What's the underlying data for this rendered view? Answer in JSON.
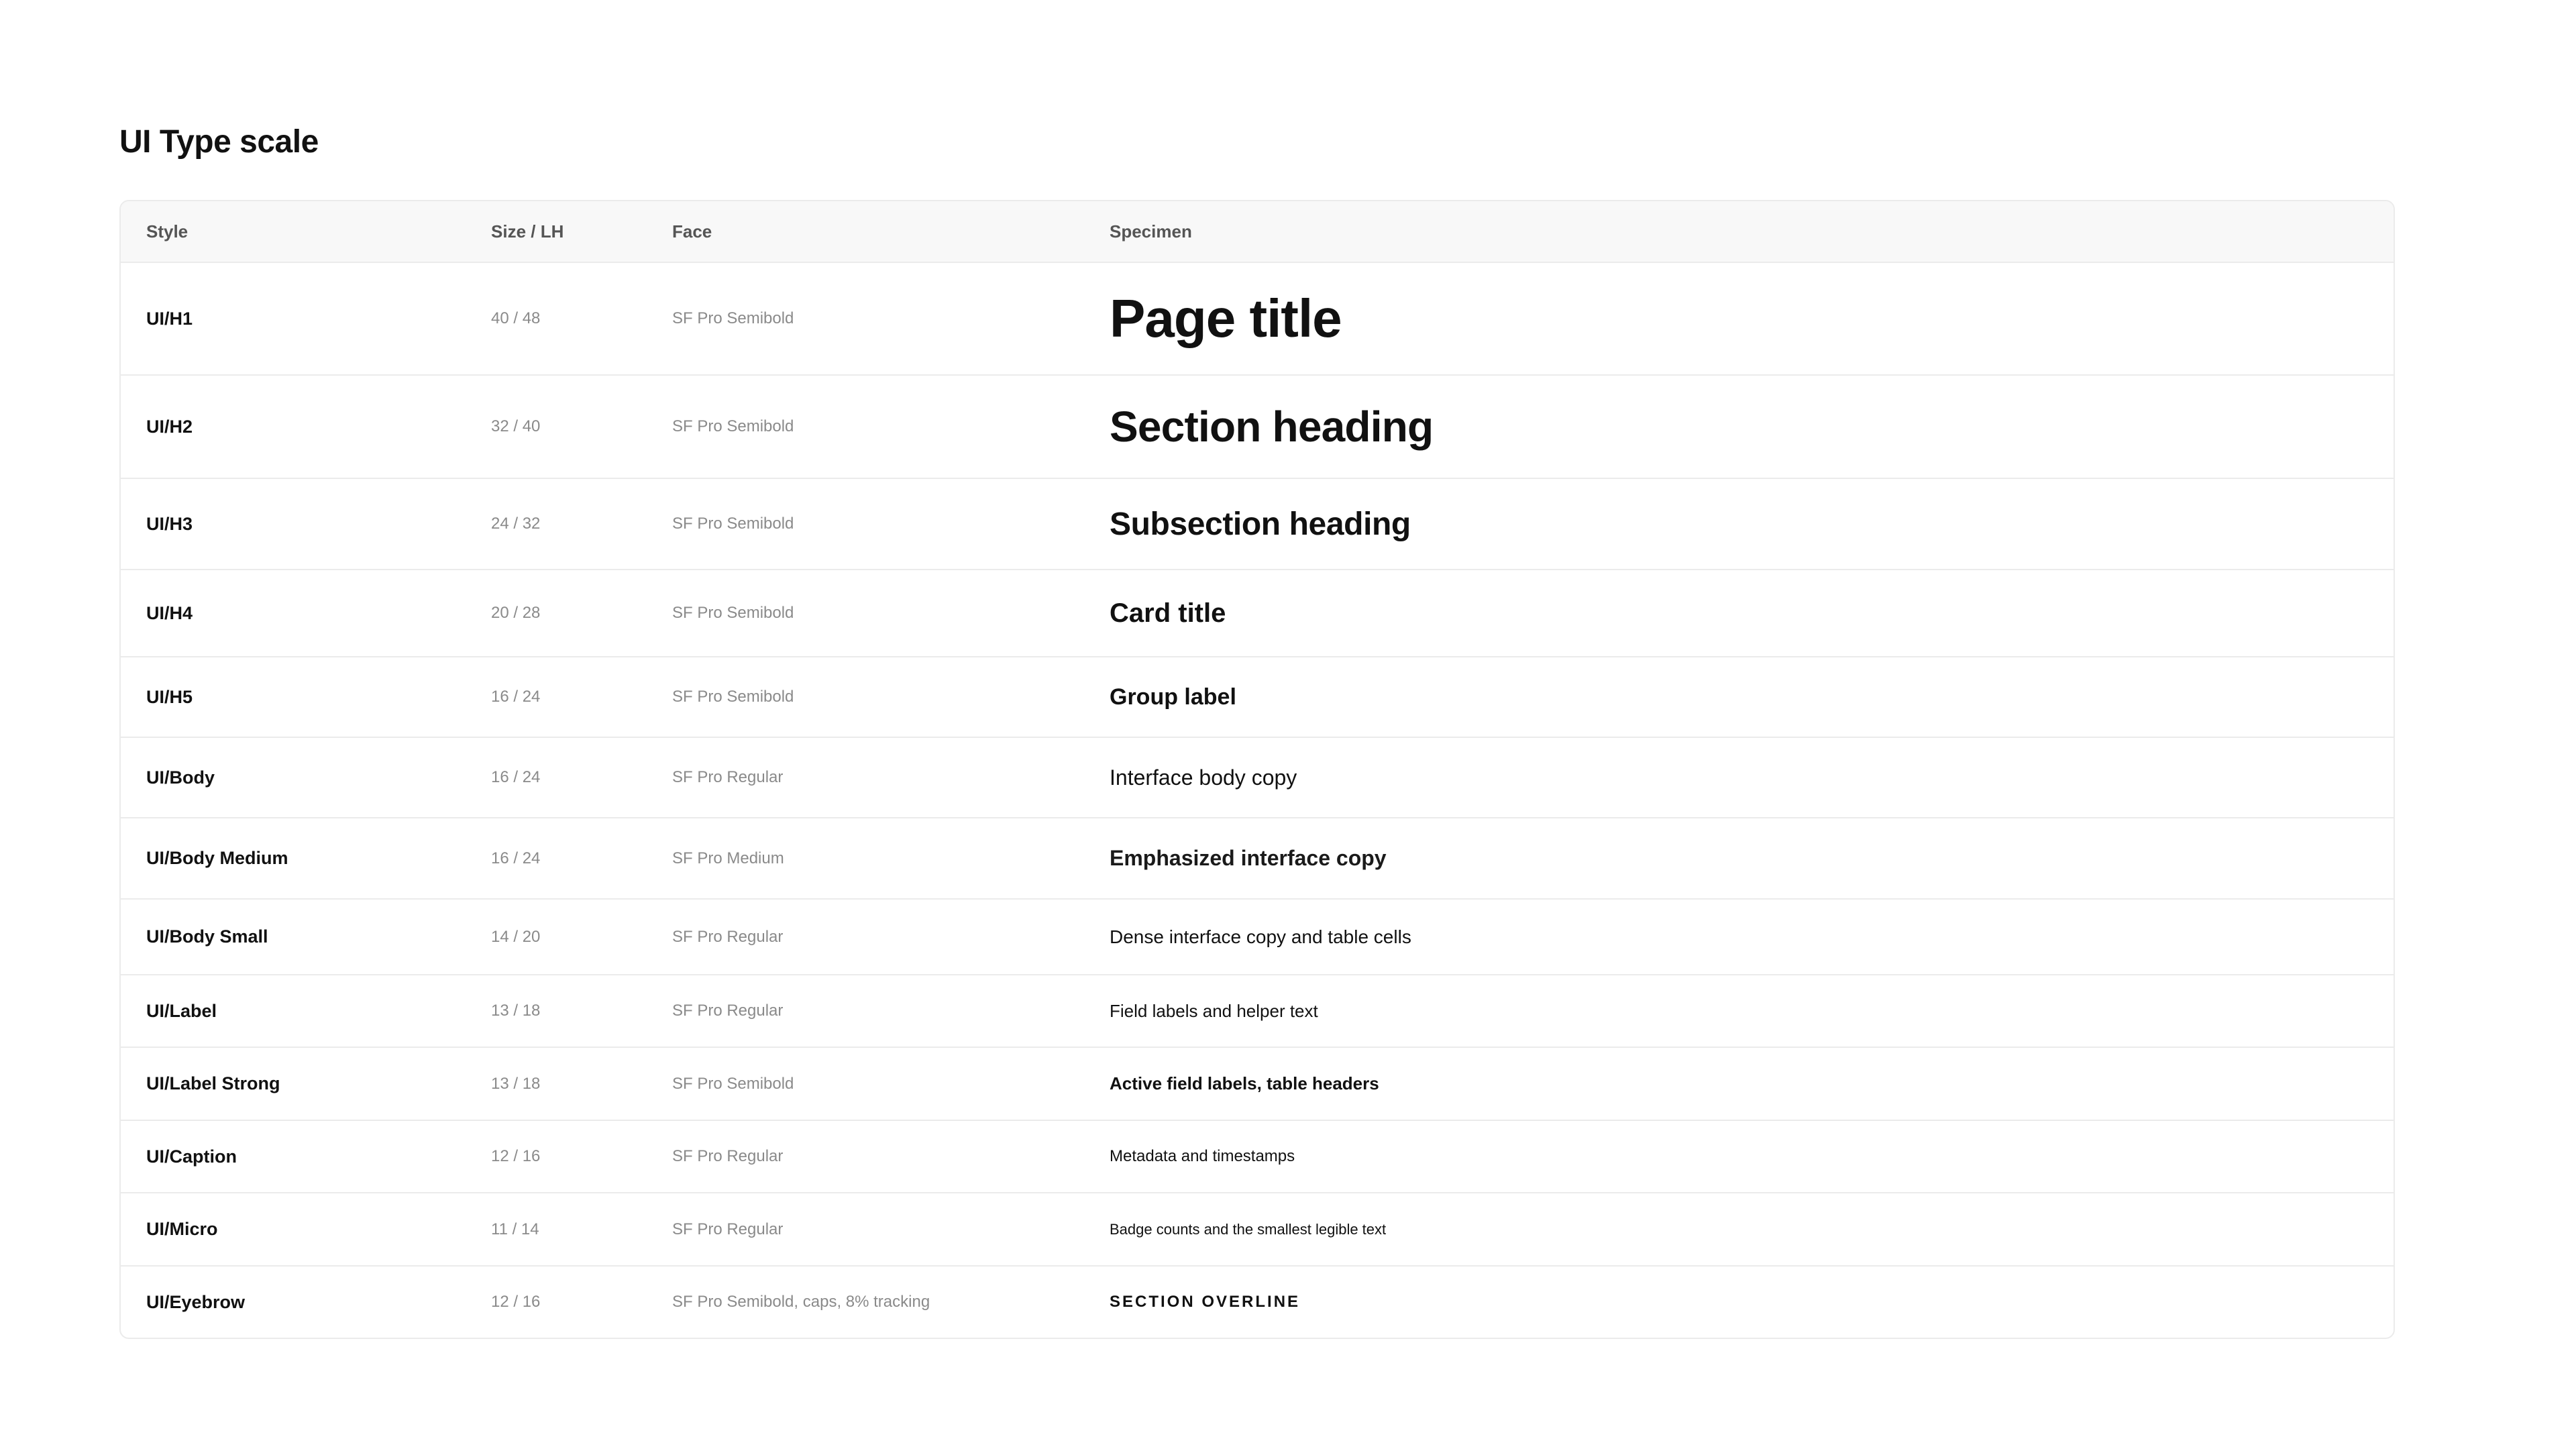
{
  "title": "UI Type scale",
  "table": {
    "headers": {
      "style": "Style",
      "size": "Size / LH",
      "face": "Face",
      "specimen": "Specimen"
    },
    "rows": [
      {
        "style": "UI/H1",
        "size": "40 / 48",
        "face": "SF Pro Semibold",
        "specimen": "Page title"
      },
      {
        "style": "UI/H2",
        "size": "32 / 40",
        "face": "SF Pro Semibold",
        "specimen": "Section heading"
      },
      {
        "style": "UI/H3",
        "size": "24 / 32",
        "face": "SF Pro Semibold",
        "specimen": "Subsection heading"
      },
      {
        "style": "UI/H4",
        "size": "20 / 28",
        "face": "SF Pro Semibold",
        "specimen": "Card title"
      },
      {
        "style": "UI/H5",
        "size": "16 / 24",
        "face": "SF Pro Semibold",
        "specimen": "Group label"
      },
      {
        "style": "UI/Body",
        "size": "16 / 24",
        "face": "SF Pro Regular",
        "specimen": "Interface body copy"
      },
      {
        "style": "UI/Body Medium",
        "size": "16 / 24",
        "face": "SF Pro Medium",
        "specimen": "Emphasized interface copy"
      },
      {
        "style": "UI/Body Small",
        "size": "14 / 20",
        "face": "SF Pro Regular",
        "specimen": "Dense interface copy and table cells"
      },
      {
        "style": "UI/Label",
        "size": "13 / 18",
        "face": "SF Pro Regular",
        "specimen": "Field labels and helper text"
      },
      {
        "style": "UI/Label Strong",
        "size": "13 / 18",
        "face": "SF Pro Semibold",
        "specimen": "Active field labels, table headers"
      },
      {
        "style": "UI/Caption",
        "size": "12 / 16",
        "face": "SF Pro Regular",
        "specimen": "Metadata and timestamps"
      },
      {
        "style": "UI/Micro",
        "size": "11 / 14",
        "face": "SF Pro Regular",
        "specimen": "Badge counts and the smallest legible text"
      },
      {
        "style": "UI/Eyebrow",
        "size": "12 / 16",
        "face": "SF Pro Semibold, caps, 8% tracking",
        "specimen": "SECTION OVERLINE"
      }
    ]
  },
  "colors": {
    "text_primary": "#111111",
    "text_muted": "#8a8a8a",
    "header_text": "#555555",
    "header_bg": "#f8f8f8",
    "border": "#ebebeb"
  }
}
